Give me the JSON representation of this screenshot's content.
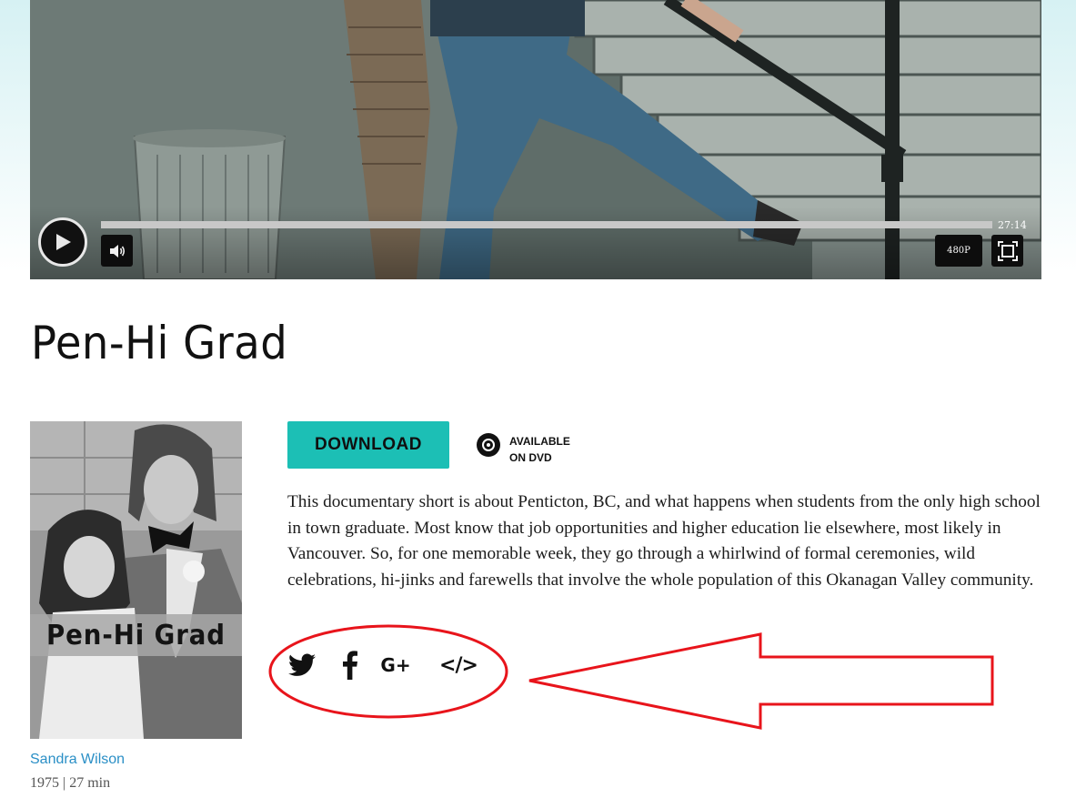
{
  "player": {
    "time": "27:14",
    "quality": "480P",
    "progress_fraction": 0.0
  },
  "film": {
    "title": "Pen-Hi Grad",
    "poster_title": "Pen-Hi Grad",
    "director": "Sandra Wilson",
    "meta": "1975 | 27 min",
    "description": "This documentary short is about Penticton, BC, and what happens when students from the only high school in town graduate. Most know that job opportunities and higher education lie elsewhere, most likely in Vancouver. So, for one memorable week, they go through a whirlwind of formal ceremonies, wild celebrations, hi-jinks and farewells that involve the whole population of this Okanagan Valley community."
  },
  "actions": {
    "download_label": "DOWNLOAD",
    "dvd_line1": "AVAILABLE",
    "dvd_line2": "ON DVD"
  },
  "share": {
    "icons": [
      "twitter-icon",
      "facebook-icon",
      "google-plus-icon",
      "embed-code-icon"
    ],
    "gplus_text": "G+",
    "embed_text": "</>"
  },
  "colors": {
    "accent": "#1cbfb5",
    "link": "#2a8fc6",
    "annotation": "#e8141b"
  }
}
